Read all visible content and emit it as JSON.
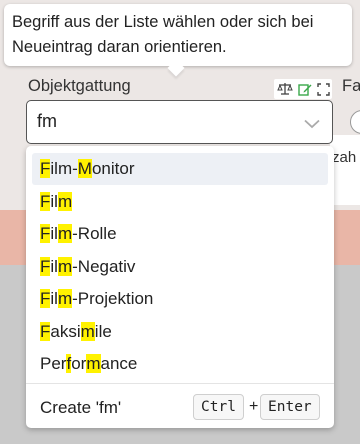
{
  "tooltip": {
    "text": "Begriff aus der Liste wählen oder sich bei Neueintrag daran orientieren."
  },
  "field": {
    "label": "Objektgattung",
    "value": "fm",
    "icons": [
      "scale-icon",
      "edit-icon",
      "expand-icon"
    ]
  },
  "right_panel": {
    "label": "Fa",
    "small_label": "zah"
  },
  "options": [
    {
      "parts": [
        {
          "t": "F",
          "h": true
        },
        {
          "t": "ilm-",
          "h": false
        },
        {
          "t": "M",
          "h": true
        },
        {
          "t": "onitor",
          "h": false
        }
      ],
      "active": true
    },
    {
      "parts": [
        {
          "t": "F",
          "h": true
        },
        {
          "t": "il",
          "h": false
        },
        {
          "t": "m",
          "h": true
        }
      ],
      "active": false
    },
    {
      "parts": [
        {
          "t": "F",
          "h": true
        },
        {
          "t": "il",
          "h": false
        },
        {
          "t": "m",
          "h": true
        },
        {
          "t": "-Rolle",
          "h": false
        }
      ],
      "active": false
    },
    {
      "parts": [
        {
          "t": "F",
          "h": true
        },
        {
          "t": "il",
          "h": false
        },
        {
          "t": "m",
          "h": true
        },
        {
          "t": "-Negativ",
          "h": false
        }
      ],
      "active": false
    },
    {
      "parts": [
        {
          "t": "F",
          "h": true
        },
        {
          "t": "il",
          "h": false
        },
        {
          "t": "m",
          "h": true
        },
        {
          "t": "-Projektion",
          "h": false
        }
      ],
      "active": false
    },
    {
      "parts": [
        {
          "t": "F",
          "h": true
        },
        {
          "t": "aksi",
          "h": false
        },
        {
          "t": "m",
          "h": true
        },
        {
          "t": "ile",
          "h": false
        }
      ],
      "active": false
    },
    {
      "parts": [
        {
          "t": "Per",
          "h": false
        },
        {
          "t": "f",
          "h": true
        },
        {
          "t": "or",
          "h": false
        },
        {
          "t": "m",
          "h": true
        },
        {
          "t": "ance",
          "h": false
        }
      ],
      "active": false
    }
  ],
  "create": {
    "label": "Create 'fm'",
    "key1": "Ctrl",
    "plus": "+",
    "key2": "Enter"
  },
  "colors": {
    "highlight": "#fff200",
    "active_row": "#edf0f5",
    "icon_green": "#3aa84a"
  }
}
